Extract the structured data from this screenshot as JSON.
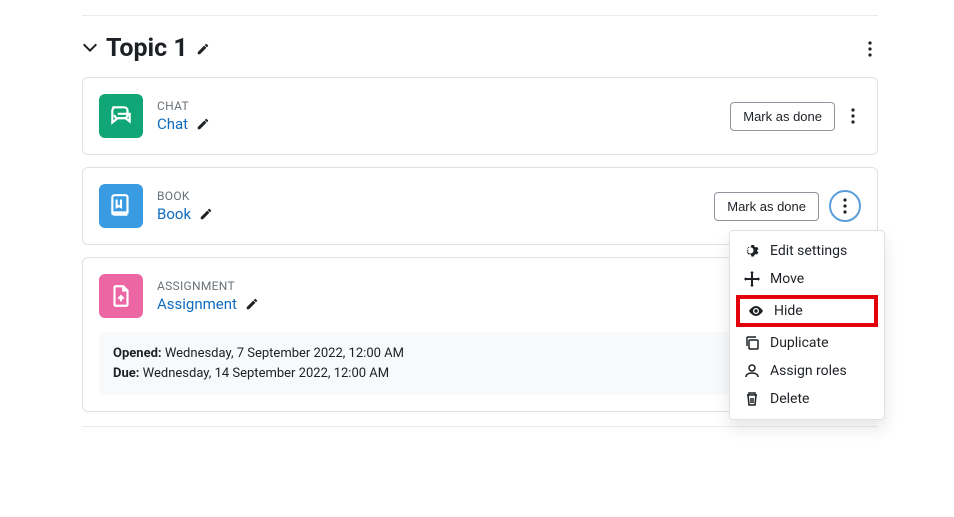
{
  "section": {
    "title": "Topic 1"
  },
  "activities": {
    "chat": {
      "type_label": "CHAT",
      "name": "Chat",
      "mark_done": "Mark as done"
    },
    "book": {
      "type_label": "BOOK",
      "name": "Book",
      "mark_done": "Mark as done",
      "menu": {
        "edit_settings": "Edit settings",
        "move": "Move",
        "hide": "Hide",
        "duplicate": "Duplicate",
        "assign_roles": "Assign roles",
        "delete": "Delete"
      }
    },
    "assignment": {
      "type_label": "ASSIGNMENT",
      "name": "Assignment",
      "opened_label": "Opened:",
      "opened": "Wednesday, 7 September 2022, 12:00 AM",
      "due_label": "Due:",
      "due": "Wednesday, 14 September 2022, 12:00 AM"
    }
  }
}
